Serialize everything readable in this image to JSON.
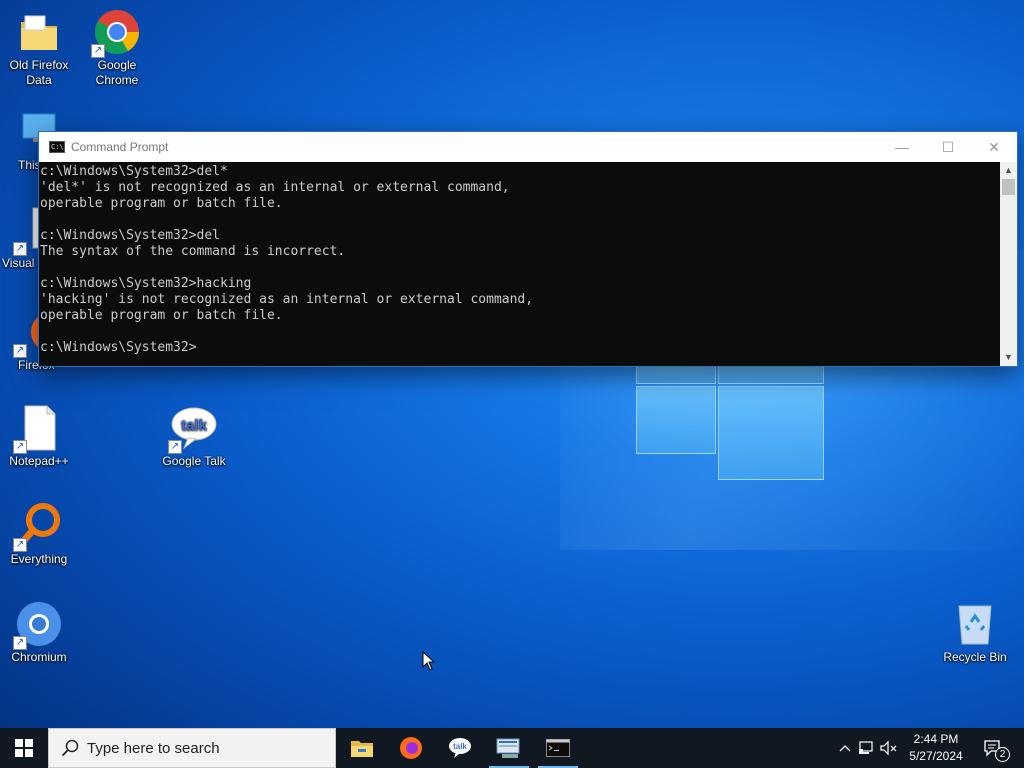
{
  "desktop": {
    "icons": [
      {
        "label": "Old Firefox Data",
        "icon": "folder-icon"
      },
      {
        "label": "Google Chrome",
        "icon": "chrome-icon"
      },
      {
        "label": "This PC",
        "icon": "this-pc-icon",
        "visible_label": "This"
      },
      {
        "label": "Visual Studio 20...",
        "icon": "vscode-icon",
        "visible_label": "Visual 20"
      },
      {
        "label": "Firefox",
        "icon": "firefox-icon"
      },
      {
        "label": "Notepad++",
        "icon": "notepad-icon"
      },
      {
        "label": "Google Talk",
        "icon": "google-talk-icon"
      },
      {
        "label": "Everything",
        "icon": "everything-icon"
      },
      {
        "label": "Chromium",
        "icon": "chromium-icon"
      },
      {
        "label": "Recycle Bin",
        "icon": "recycle-bin-icon"
      }
    ]
  },
  "cmd_window": {
    "title": "Command Prompt",
    "console_text": "c:\\Windows\\System32>del*\n'del*' is not recognized as an internal or external command,\noperable program or batch file.\n\nc:\\Windows\\System32>del\nThe syntax of the command is incorrect.\n\nc:\\Windows\\System32>hacking\n'hacking' is not recognized as an internal or external command,\noperable program or batch file.\n\nc:\\Windows\\System32>",
    "minimize_glyph": "—",
    "maximize_glyph": "☐",
    "close_glyph": "✕"
  },
  "taskbar": {
    "search_placeholder": "Type here to search",
    "apps": [
      {
        "name": "File Explorer",
        "icon": "file-explorer-icon",
        "open": false
      },
      {
        "name": "Firefox",
        "icon": "firefox-icon",
        "open": false
      },
      {
        "name": "Google Talk",
        "icon": "google-talk-icon",
        "open": false
      },
      {
        "name": "Network Connections",
        "icon": "network-app-icon",
        "open": true
      },
      {
        "name": "Command Prompt",
        "icon": "cmd-icon",
        "open": true
      }
    ],
    "clock": {
      "time": "2:44 PM",
      "date": "5/27/2024"
    },
    "notification_count": "2"
  }
}
